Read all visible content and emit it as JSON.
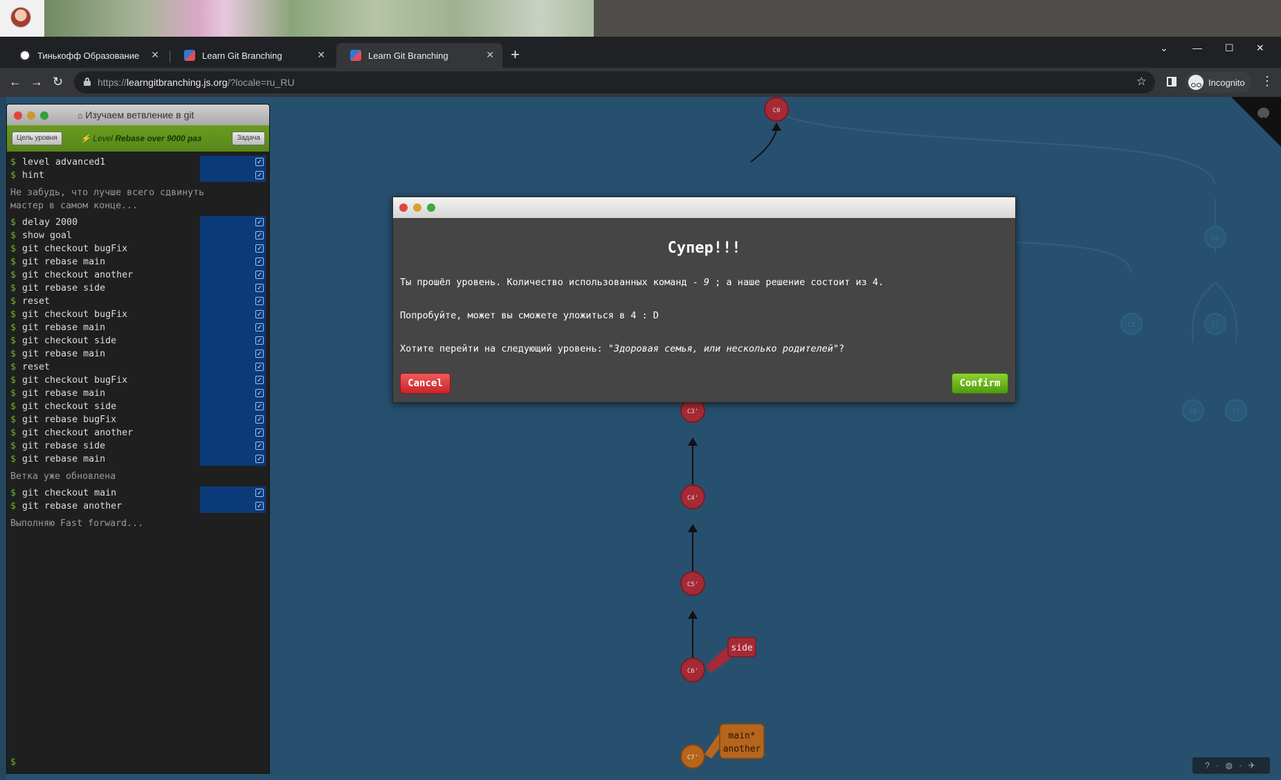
{
  "browser": {
    "tabs": [
      {
        "label": "Тинькофф Образование",
        "active": false,
        "favicon": "tinkoff-icon"
      },
      {
        "label": "Learn Git Branching",
        "active": false,
        "favicon": "learngitbranching-icon"
      },
      {
        "label": "Learn Git Branching",
        "active": true,
        "favicon": "learngitbranching-icon"
      }
    ],
    "url_scheme": "https://",
    "url_host": "learngitbranching.js.org",
    "url_path": "/?locale=ru_RU",
    "incognito_label": "Incognito"
  },
  "terminal": {
    "title": "Изучаем ветвление в git",
    "goal_button": "Цель уровня",
    "task_button": "Задача",
    "level_prefix": "Level",
    "level_name": "Rebase over 9000 раз",
    "block1": [
      "level advanced1",
      "hint"
    ],
    "hint_message": "Не забудь, что лучше всего сдвинуть\nмастер в самом конце...",
    "block2": [
      "delay 2000",
      "show goal",
      "git checkout bugFix",
      "git rebase main",
      "git checkout another",
      "git rebase side",
      "reset",
      "git checkout bugFix",
      "git rebase main",
      "git checkout side",
      "git rebase main",
      "reset",
      "git checkout bugFix",
      "git rebase main",
      "git checkout side",
      "git rebase bugFix",
      "git checkout another",
      "git rebase side",
      "git rebase main"
    ],
    "up_to_date_message": "Ветка уже обновлена",
    "block3": [
      "git checkout main",
      "git rebase another"
    ],
    "ff_message": "Выполняю Fast forward...",
    "prompt": "$",
    "colors": {
      "prompt_green": "#6fb52c",
      "status_blue": "#0b3a7a",
      "level_bar_green": "#6a9c1f"
    }
  },
  "tree": {
    "commits": [
      "C0",
      "C3'",
      "C4'",
      "C5'",
      "C6'",
      "C7'",
      "C1",
      "C2",
      "C4",
      "C6",
      "C7"
    ],
    "branch_side": "side",
    "branch_main": "main*",
    "branch_another": "another",
    "colors": {
      "commit": "#a52a35",
      "head_commit": "#b5651d",
      "background": "#27506f"
    }
  },
  "modal": {
    "title": "Супер!!!",
    "line1_a": "Ты прошёл уровень. Количество использованных команд - ",
    "line1_count": "9",
    "line1_b": " ; а наше решение состоит из 4.",
    "line2": "Попробуйте, может вы сможете уложиться в 4 : D",
    "line3_a": "Хотите перейти на следующий уровень: ",
    "line3_next": "\"Здоровая семья, или несколько родителей\"",
    "line3_b": "?",
    "cancel_label": "Cancel",
    "confirm_label": "Confirm"
  }
}
